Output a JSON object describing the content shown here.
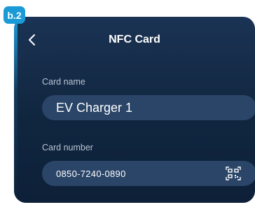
{
  "badge": {
    "label": "b.2"
  },
  "header": {
    "title": "NFC Card",
    "back_icon": "chevron-left-icon"
  },
  "form": {
    "card_name": {
      "label": "Card name",
      "value": "EV Charger 1"
    },
    "card_number": {
      "label": "Card number",
      "value": "0850-7240-0890",
      "scan_icon": "qr-scan-icon"
    }
  },
  "colors": {
    "accent": "#1a9ad6",
    "panel": "#10263f",
    "field_bg": "#2a4568",
    "text": "#ffffff",
    "label": "#b9c4d3"
  }
}
